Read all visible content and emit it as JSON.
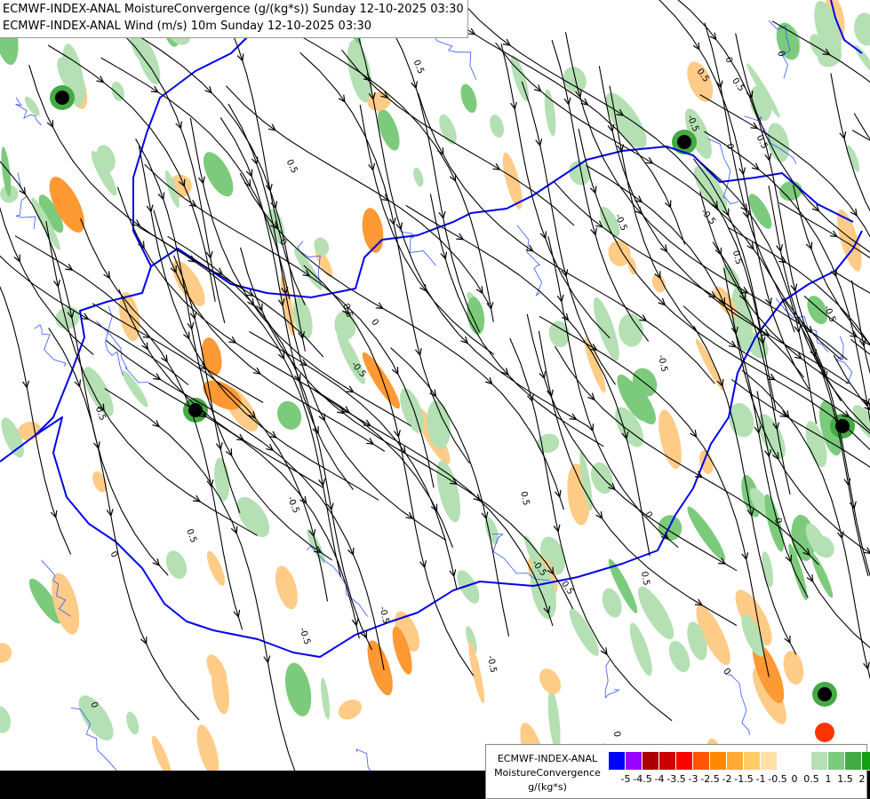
{
  "header": {
    "line1": "ECMWF-INDEX-ANAL MoistureConvergence (g/(kg*s)) Sunday 12-10-2025 03:30",
    "line2": "ECMWF-INDEX-ANAL Wind (m/s) 10m Sunday 12-10-2025 03:30"
  },
  "legend": {
    "title_line1": "ECMWF-INDEX-ANAL",
    "title_line2": "MoistureConvergence",
    "units": "g/(kg*s)",
    "colors": [
      "#0000ff",
      "#9900ff",
      "#aa0000",
      "#cc0000",
      "#ff0000",
      "#ff5500",
      "#ff8800",
      "#ffaa33",
      "#ffcc66",
      "#ffe0a8",
      "#ffffff",
      "#ffffff",
      "#b4e0b4",
      "#7ccb7c",
      "#44aa44",
      "#11a011"
    ],
    "ticks": [
      "-5",
      "-4.5",
      "-4",
      "-3.5",
      "-3",
      "-2.5",
      "-2",
      "-1.5",
      "-1",
      "-0.5",
      "0",
      "0.5",
      "1",
      "1.5",
      "2"
    ]
  },
  "map": {
    "contour_labels": [
      "0.5",
      "0",
      "-0.5"
    ],
    "colors": {
      "border": "#0000ee",
      "river": "#3355ff",
      "streamline": "#000000",
      "positive_fill": "#b4e0b4",
      "positive_fill_strong": "#7ccb7c",
      "negative_fill": "#ffcc88",
      "negative_fill_strong": "#ff9933"
    }
  }
}
